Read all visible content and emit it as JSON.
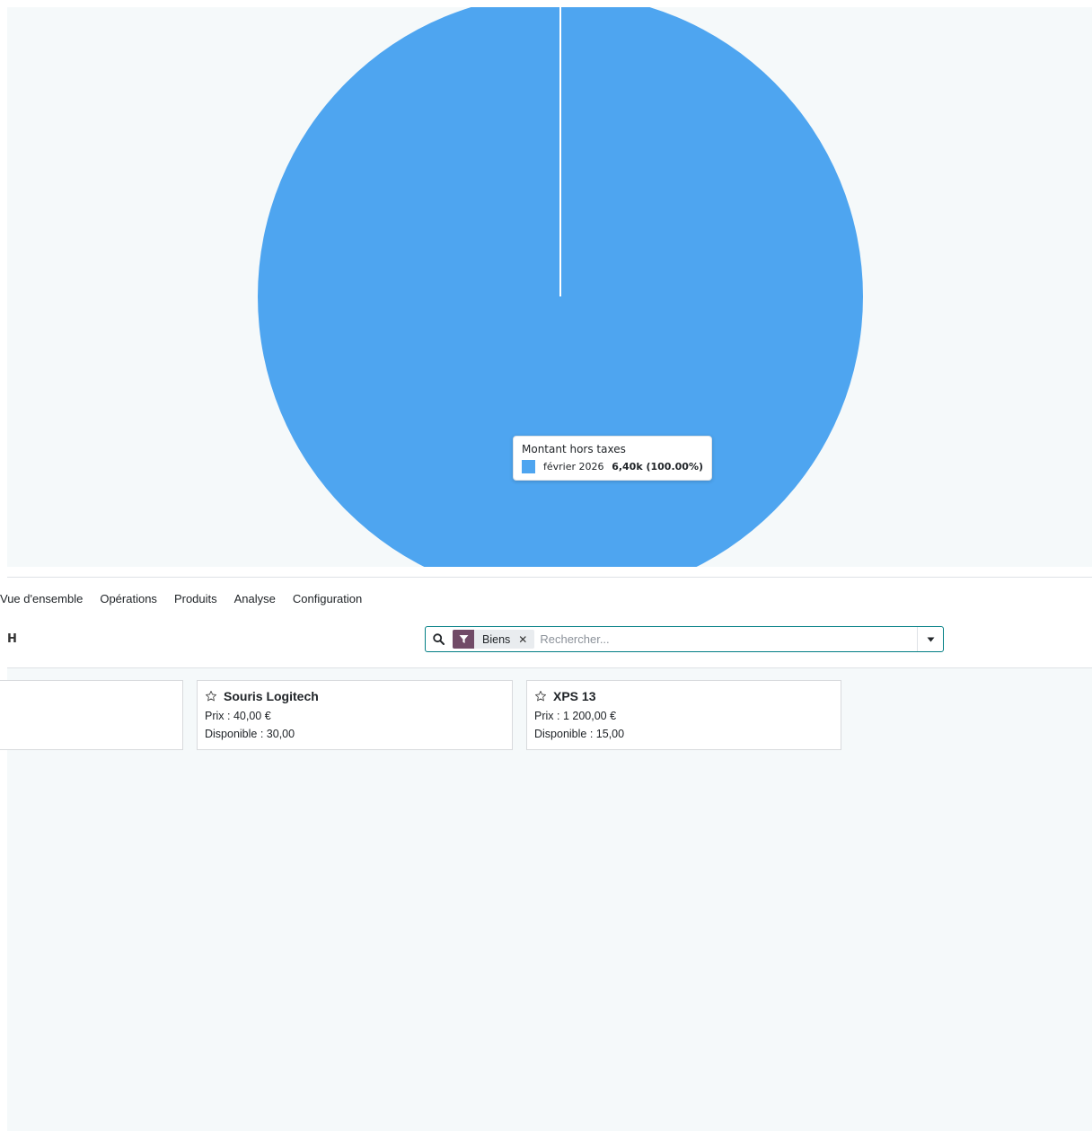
{
  "chart": {
    "tooltip": {
      "title": "Montant hors taxes",
      "label": "février 2026",
      "value": "6,40k (100.00%)"
    },
    "slice_color": "#4ea5f0"
  },
  "chart_data": {
    "type": "pie",
    "categories": [
      "février 2026"
    ],
    "series": [
      {
        "name": "Montant hors taxes",
        "values": [
          6400
        ]
      }
    ],
    "colors": [
      "#4ea5f0"
    ],
    "title": ""
  },
  "menu": {
    "items": [
      {
        "label": "Vue d'ensemble"
      },
      {
        "label": "Opérations"
      },
      {
        "label": "Produits"
      },
      {
        "label": "Analyse"
      },
      {
        "label": "Configuration"
      }
    ]
  },
  "control": {
    "breadcrumb_glyph": "H",
    "search": {
      "facet_label": "Biens",
      "facet_remove": "✕",
      "placeholder": "Rechercher..."
    }
  },
  "colors": {
    "accent": "#017e84",
    "facet": "#714b67",
    "chart": "#4ea5f0"
  },
  "kanban": {
    "cards": [
      {
        "name": "",
        "price_line": "",
        "stock_line": ""
      },
      {
        "name": "Souris Logitech",
        "price_line": "Prix : 40,00 €",
        "stock_line": "Disponible : 30,00"
      },
      {
        "name": "XPS 13",
        "price_line": "Prix : 1 200,00 €",
        "stock_line": "Disponible : 15,00"
      }
    ]
  }
}
